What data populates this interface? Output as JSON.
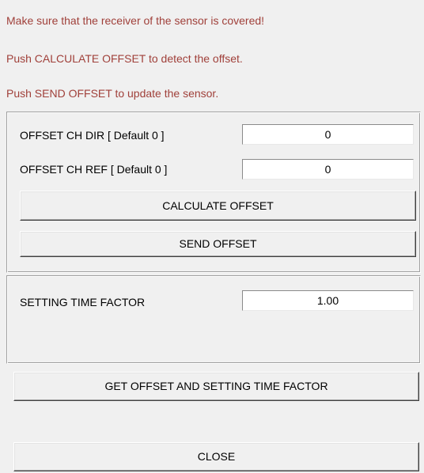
{
  "messages": {
    "line1": "Make sure that the receiver of the sensor is covered!",
    "line2": "Push CALCULATE OFFSET to detect the offset.",
    "line3": "Push SEND OFFSET to update the sensor."
  },
  "offset_group": {
    "ch_dir_label": "OFFSET CH DIR [ Default 0 ]",
    "ch_dir_value": "0",
    "ch_ref_label": "OFFSET CH REF [ Default 0 ]",
    "ch_ref_value": "0",
    "calculate_button": "CALCULATE OFFSET",
    "send_button": "SEND OFFSET"
  },
  "time_group": {
    "setting_time_factor_label": "SETTING TIME FACTOR",
    "setting_time_factor_value": "1.00"
  },
  "buttons": {
    "get_offset": "GET OFFSET AND SETTING TIME FACTOR",
    "close": "CLOSE"
  },
  "colors": {
    "message_text": "#a0403a",
    "background": "#f0f0f0"
  }
}
